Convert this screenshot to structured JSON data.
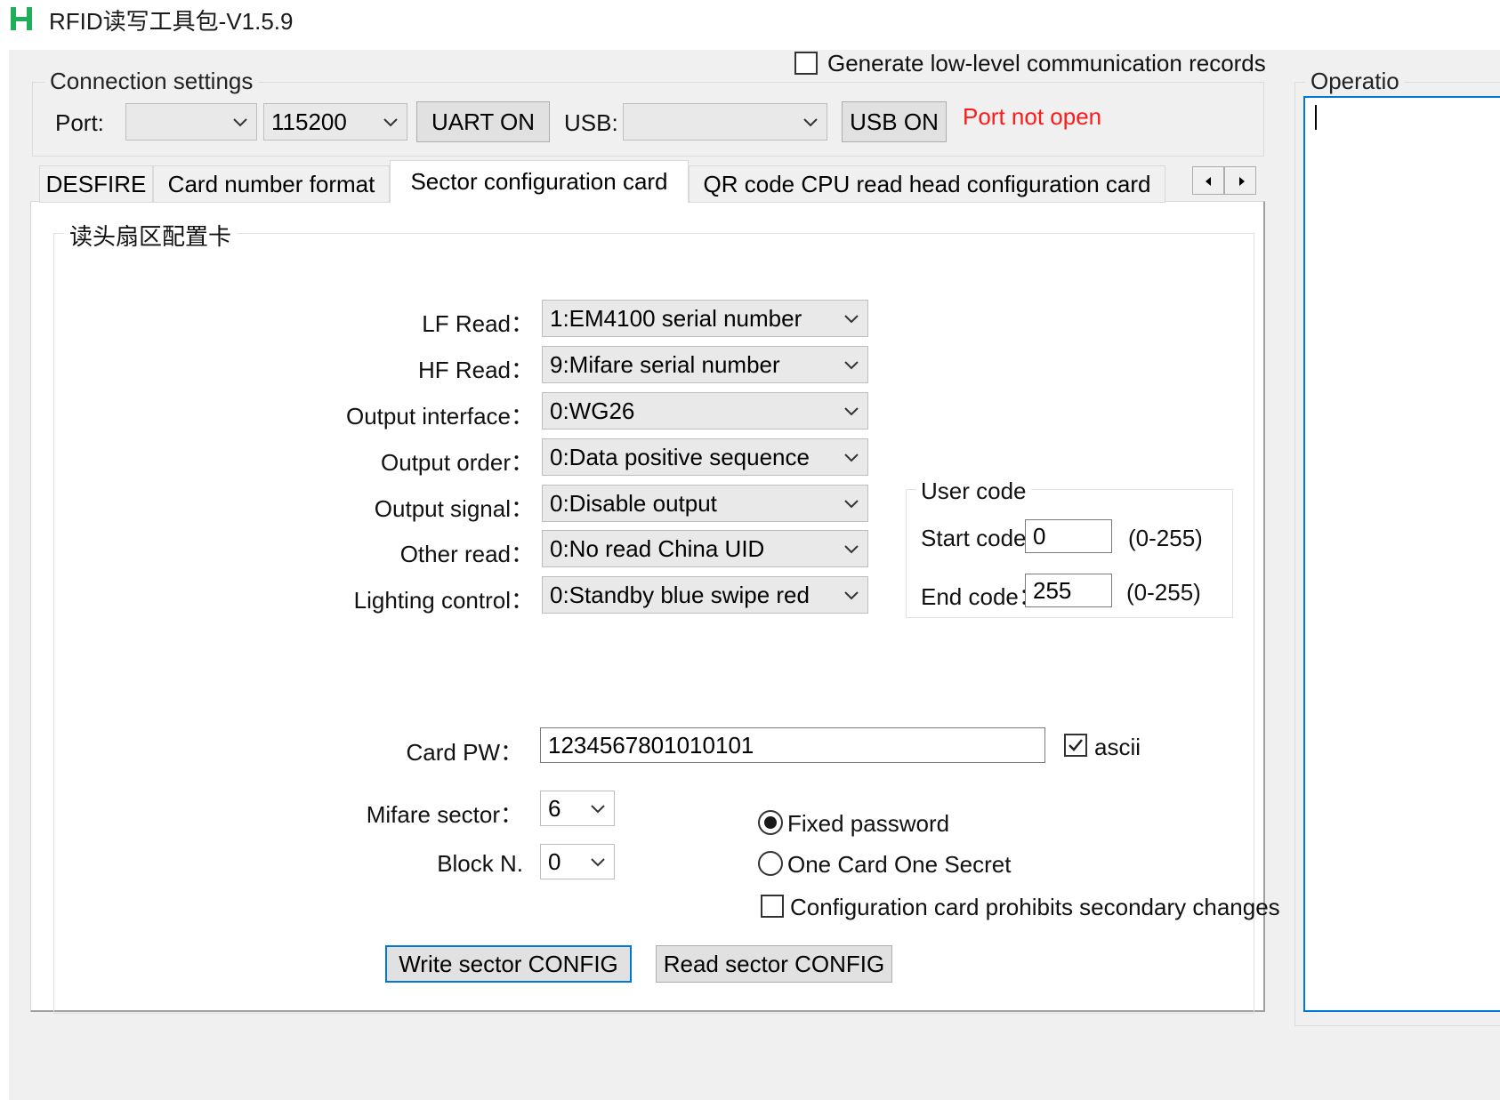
{
  "window": {
    "title": "RFID读写工具包-V1.5.9",
    "icon": "app-h-icon"
  },
  "top_option": {
    "label": "Generate low-level communication records",
    "checked": false
  },
  "connection": {
    "legend": "Connection settings",
    "port_label": "Port:",
    "port_value": "",
    "baud_value": "115200",
    "uart_button": "UART ON",
    "usb_label": "USB:",
    "usb_value": "",
    "usb_button": "USB ON",
    "status": "Port not open",
    "status_color": "#ff1a1a"
  },
  "operation_panel": {
    "legend": "Operatio"
  },
  "tabs": [
    {
      "label": "DESFIRE",
      "active": false
    },
    {
      "label": "Card number format",
      "active": false
    },
    {
      "label": "Sector configuration card",
      "active": true
    },
    {
      "label": "QR code CPU read head configuration card",
      "active": false
    }
  ],
  "sector_group": {
    "legend": "读头扇区配置卡",
    "fields": [
      {
        "label": "LF Read：",
        "value": "1:EM4100 serial number"
      },
      {
        "label": "HF Read：",
        "value": "9:Mifare serial number"
      },
      {
        "label": "Output interface：",
        "value": "0:WG26"
      },
      {
        "label": "Output order：",
        "value": "0:Data positive sequence"
      },
      {
        "label": "Output signal：",
        "value": "0:Disable output"
      },
      {
        "label": "Other read：",
        "value": "0:No read China UID"
      },
      {
        "label": "Lighting control：",
        "value": "0:Standby blue swipe red"
      }
    ],
    "user_code": {
      "legend": "User code",
      "start_label": "Start code",
      "start_value": "0",
      "start_range": "(0-255)",
      "end_label": "End code：",
      "end_value": "255",
      "end_range": "(0-255)"
    },
    "card_pw": {
      "label": "Card PW：",
      "value": "12345678010101​01",
      "ascii_label": "ascii",
      "ascii_checked": true
    },
    "mifare_sector": {
      "label": "Mifare sector：",
      "value": "6"
    },
    "block": {
      "label": "Block N.",
      "value": "0"
    },
    "password_mode": {
      "options": [
        "Fixed password",
        "One Card One Secret"
      ],
      "selected": "Fixed password"
    },
    "prohibit": {
      "label": "Configuration card prohibits secondary changes",
      "checked": false
    },
    "write_button": "Write sector CONFIG",
    "read_button": "Read sector CONFIG"
  },
  "colors": {
    "accent": "#0078d7",
    "icon_green": "#1fae5a"
  }
}
